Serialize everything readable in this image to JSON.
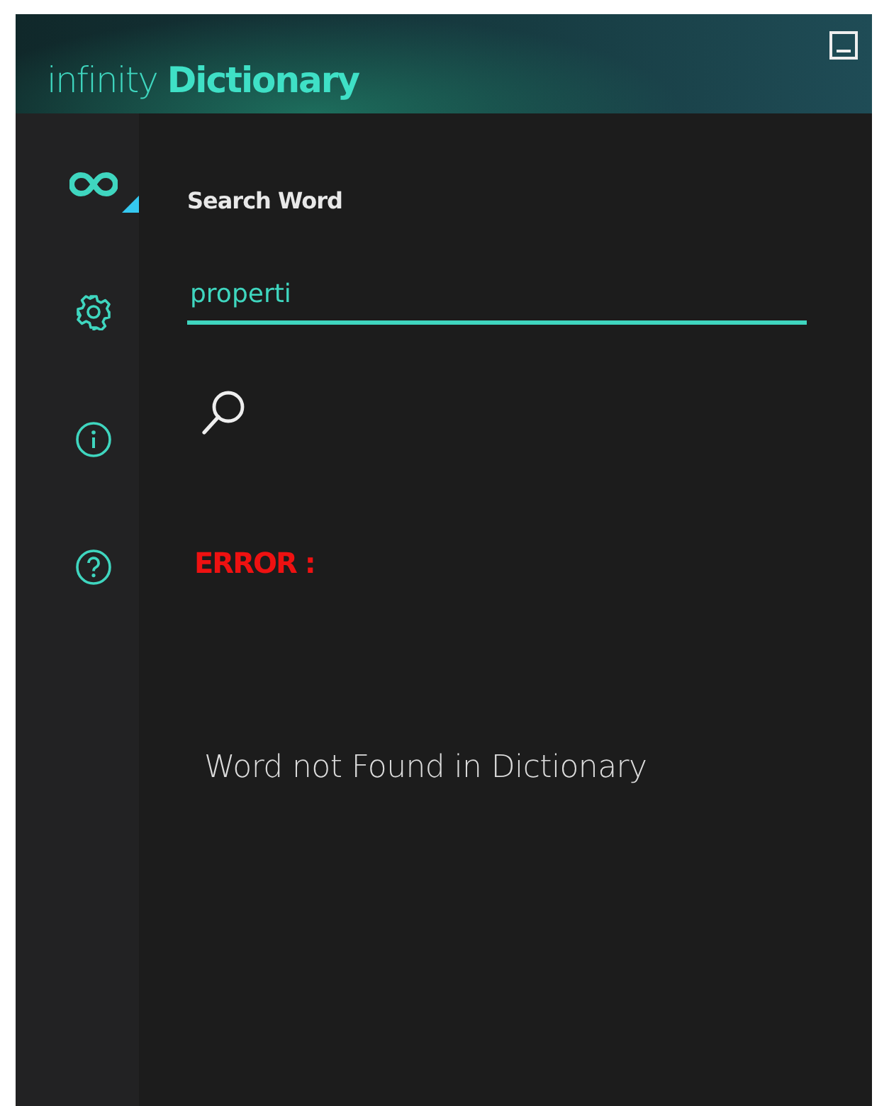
{
  "window": {
    "title_light": "infinity",
    "title_bold": "Dictionary"
  },
  "sidebar": {
    "items": [
      {
        "kind": "infinity",
        "selected": true
      },
      {
        "kind": "settings",
        "selected": false
      },
      {
        "kind": "info",
        "selected": false
      },
      {
        "kind": "help",
        "selected": false
      }
    ]
  },
  "search": {
    "label": "Search Word",
    "value": "properti"
  },
  "error": {
    "label": "ERROR :",
    "message": "Word not Found in Dictionary"
  }
}
